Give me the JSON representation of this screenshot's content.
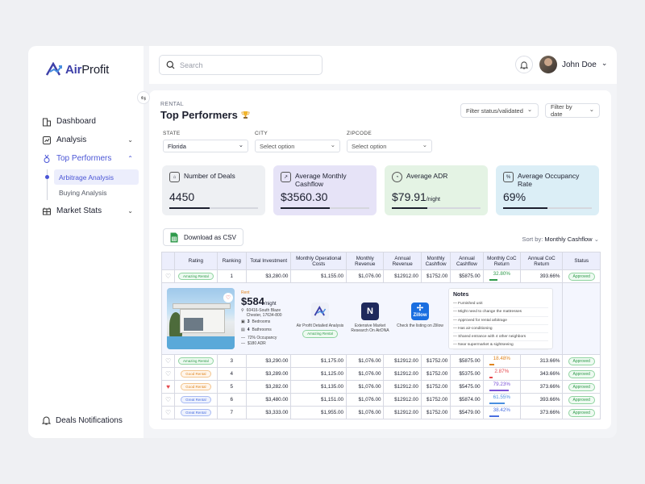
{
  "brand": {
    "name_a": "Air",
    "name_b": "Profit",
    "color": "#4a55d6"
  },
  "sidebar": {
    "items": [
      {
        "label": "Dashboard",
        "icon": "building-icon"
      },
      {
        "label": "Analysis",
        "icon": "chart-icon"
      },
      {
        "label": "Top Performers",
        "icon": "medal-icon"
      },
      {
        "label": "Market Stats",
        "icon": "grid-icon"
      }
    ],
    "sub_items": [
      "Arbitrage Analysis",
      "Buying Analysis"
    ],
    "deals_notifications": "Deals Notifications"
  },
  "topbar": {
    "search_placeholder": "Search",
    "user_name": "John Doe"
  },
  "page": {
    "eyebrow": "RENTAL",
    "title": "Top Performers",
    "filter_status": "Filter status/validated",
    "filter_date": "Filter by date"
  },
  "filters": [
    {
      "label": "STATE",
      "value": "Florida"
    },
    {
      "label": "CITY",
      "value": "Select option"
    },
    {
      "label": "ZIPCODE",
      "value": "Select option"
    }
  ],
  "cards": [
    {
      "label": "Number of Deals",
      "value": "4450",
      "unit": "",
      "bg": "#eef0f3",
      "progress": 0.45
    },
    {
      "label": "Average Monthly Cashflow",
      "value": "$3560.30",
      "unit": "",
      "bg": "#e6e3f7",
      "progress": 0.55
    },
    {
      "label": "Average ADR",
      "value": "$79.91",
      "unit": "/night",
      "bg": "#e4f3e4",
      "progress": 0.4
    },
    {
      "label": "Average Occupancy Rate",
      "value": "69%",
      "unit": "",
      "bg": "#dbeef6",
      "progress": 0.5
    }
  ],
  "actions": {
    "download": "Download as CSV",
    "sort_label": "Sort by:",
    "sort_value": "Monthly Cashflow"
  },
  "table": {
    "headers": [
      "",
      "Rating",
      "Ranking",
      "Total Investment",
      "Monthly Operational Costs",
      "Monthly Revenue",
      "Annual Revenue",
      "Monthly Cashflow",
      "Annual Cashflow",
      "Monthly CoC Return",
      "Annual CoC Return",
      "Status"
    ],
    "rows": [
      {
        "rating": "Amazing Rental",
        "tag": "green",
        "rank": "1",
        "inv": "$3,280.00",
        "moc": "$1,155.00",
        "mrev": "$1,076.00",
        "arev": "$12912.00",
        "mcf": "$1752.00",
        "acf": "$5875.00",
        "mcoc": "32.80%",
        "coc_color": "#2f9a4b",
        "coc_fill": 0.33,
        "acoc": "393.66%",
        "status": "Approved",
        "fav": false
      },
      {
        "rating": "Amazing Rental",
        "tag": "green",
        "rank": "3",
        "inv": "$3,290.00",
        "moc": "$1,175.00",
        "mrev": "$1,076.00",
        "arev": "$12912.00",
        "mcf": "$1752.00",
        "acf": "$5875.00",
        "mcoc": "18.48%",
        "coc_color": "#e0851f",
        "coc_fill": 0.18,
        "acoc": "313.66%",
        "status": "Approved",
        "fav": false
      },
      {
        "rating": "Good Rental",
        "tag": "orange",
        "rank": "4",
        "inv": "$3,289.00",
        "moc": "$1,125.00",
        "mrev": "$1,076.00",
        "arev": "$12912.00",
        "mcf": "$1752.00",
        "acf": "$5375.00",
        "mcoc": "2.87%",
        "coc_color": "#e5484d",
        "coc_fill": 0.03,
        "acoc": "343.66%",
        "status": "Approved",
        "fav": false
      },
      {
        "rating": "Good Rental",
        "tag": "orange",
        "rank": "5",
        "inv": "$3,282.00",
        "moc": "$1,135.00",
        "mrev": "$1,076.00",
        "arev": "$12912.00",
        "mcf": "$1752.00",
        "acf": "$5475.00",
        "mcoc": "79.23%",
        "coc_color": "#7b52d6",
        "coc_fill": 0.79,
        "acoc": "373.66%",
        "status": "Approved",
        "fav": true
      },
      {
        "rating": "Great Rental",
        "tag": "blue",
        "rank": "6",
        "inv": "$3,480.00",
        "moc": "$1,151.00",
        "mrev": "$1,076.00",
        "arev": "$12912.00",
        "mcf": "$1752.00",
        "acf": "$5874.00",
        "mcoc": "61.55%",
        "coc_color": "#4a8fe0",
        "coc_fill": 0.62,
        "acoc": "393.66%",
        "status": "Approved",
        "fav": false
      },
      {
        "rating": "Great Rental",
        "tag": "blue",
        "rank": "7",
        "inv": "$3,333.00",
        "moc": "$1,955.00",
        "mrev": "$1,076.00",
        "arev": "$12912.00",
        "mcf": "$1752.00",
        "acf": "$5479.00",
        "mcoc": "38.42%",
        "coc_color": "#4a6fe0",
        "coc_fill": 0.38,
        "acoc": "373.66%",
        "status": "Approved",
        "fav": false
      }
    ]
  },
  "detail": {
    "rent_label": "Rent",
    "rent_value": "$584",
    "rent_unit": "/night",
    "address": "60416-South Blaze Chester, 17634-800",
    "bedrooms_n": "3",
    "bedrooms": "Bedrooms",
    "bathrooms_n": "4",
    "bathrooms": "Bathrooms",
    "occupancy": "72% Occupancy",
    "adr": "$180 ADR",
    "tools": [
      {
        "label": "Air Profit Detailed Analysis",
        "badge": "Amazing Rental"
      },
      {
        "label": "Extensive Market Research On AirDNA",
        "badge": ""
      },
      {
        "label": "Check the listing on Zillow",
        "badge": "Zillow"
      }
    ],
    "notes_title": "Notes",
    "notes": [
      "Furnished unit",
      "Might need to change the mattresses",
      "Approved for rental arbitrage",
      "Has air-conditioning",
      "Shared entrance with 4 other neighbors",
      "Near supermarket & sightseeing"
    ]
  }
}
